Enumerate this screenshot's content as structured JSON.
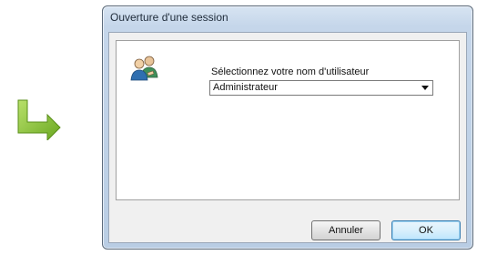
{
  "window": {
    "title": "Ouverture d'une session"
  },
  "login": {
    "prompt": "Sélectionnez votre nom d'utilisateur",
    "selected_user": "Administrateur"
  },
  "buttons": {
    "cancel_label": "Annuler",
    "ok_label": "OK"
  },
  "icons": {
    "arrow": "arrow-down-right-icon",
    "users": "users-icon",
    "dropdown": "chevron-down-icon"
  },
  "colors": {
    "arrow_green": "#8fc23a",
    "ok_border": "#3c7fb1"
  }
}
